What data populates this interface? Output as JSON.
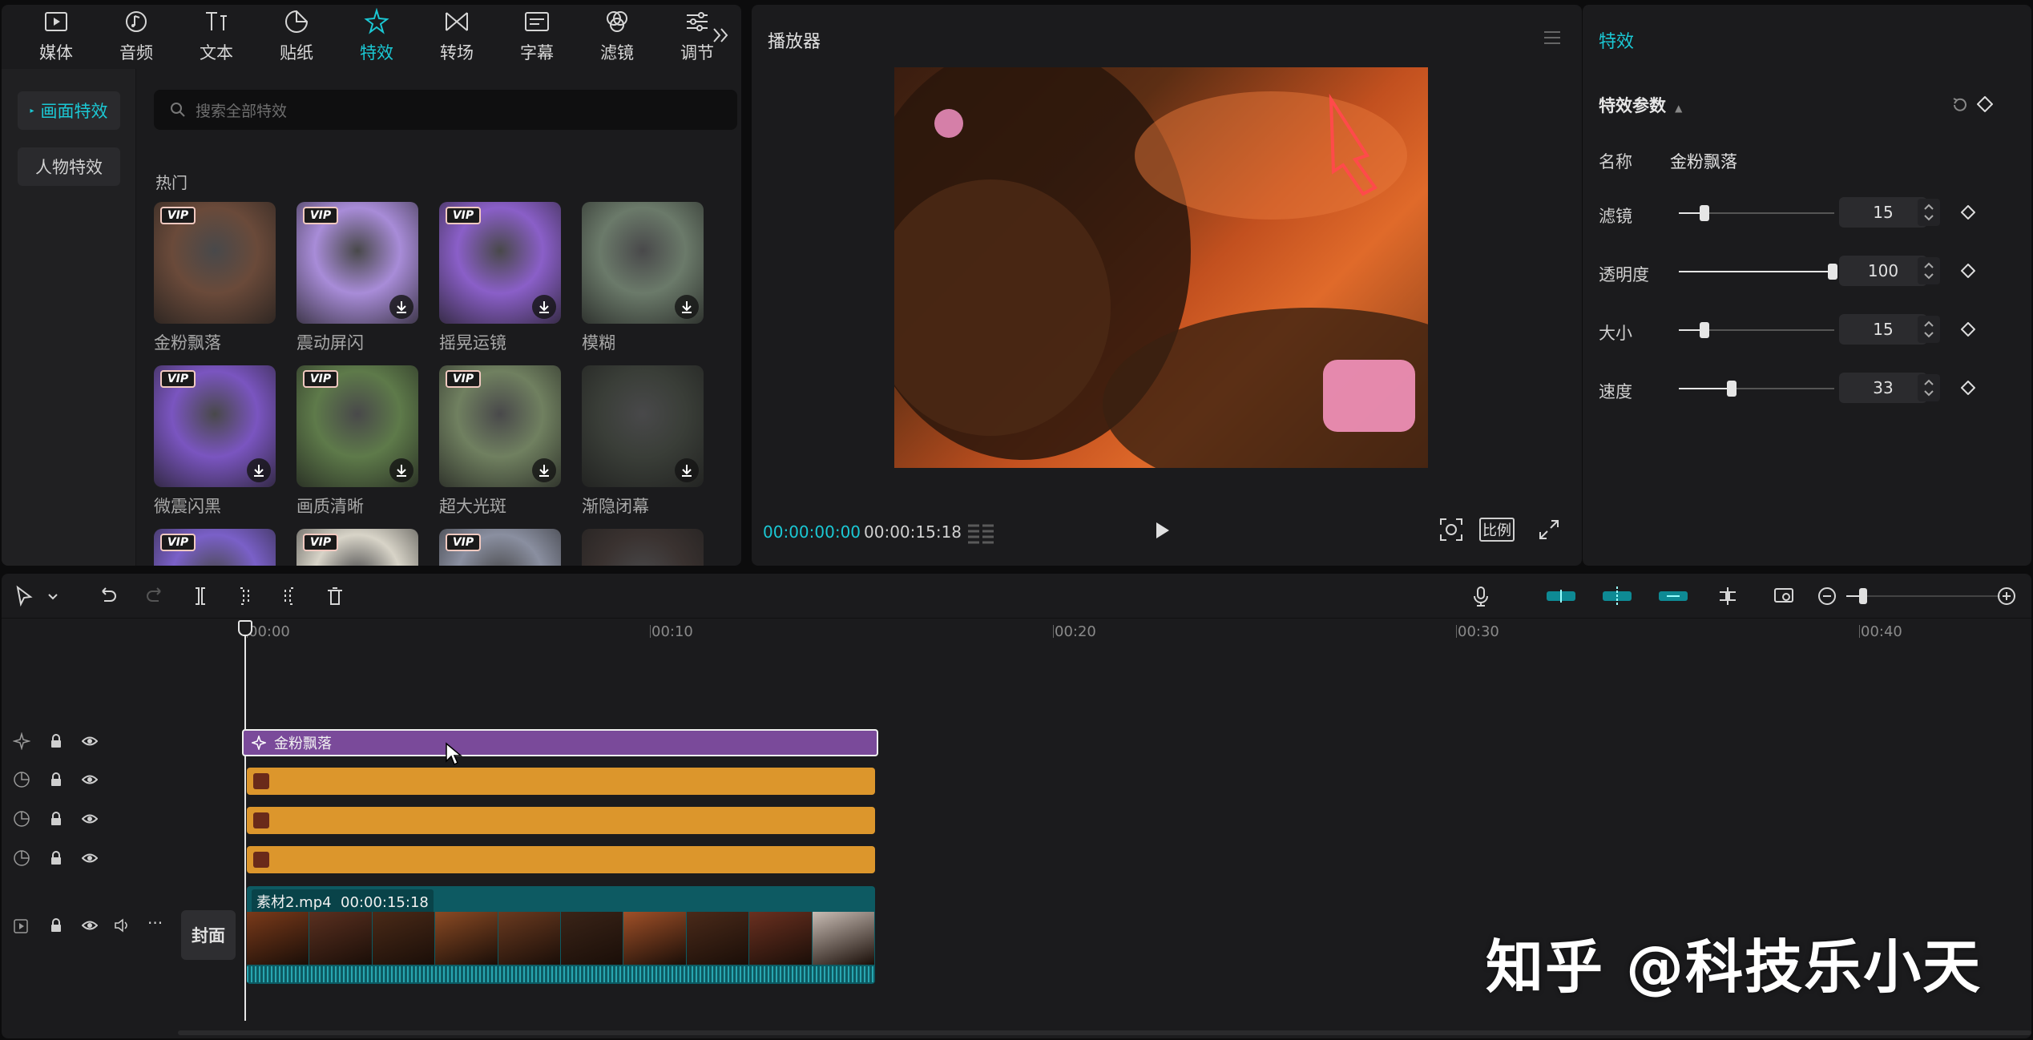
{
  "library": {
    "tabs": [
      {
        "label": "媒体",
        "icon": "media-icon"
      },
      {
        "label": "音频",
        "icon": "audio-icon"
      },
      {
        "label": "文本",
        "icon": "text-icon"
      },
      {
        "label": "贴纸",
        "icon": "sticker-icon"
      },
      {
        "label": "特效",
        "icon": "effect-star-icon",
        "active": true
      },
      {
        "label": "转场",
        "icon": "transition-icon"
      },
      {
        "label": "字幕",
        "icon": "subtitle-icon"
      },
      {
        "label": "滤镜",
        "icon": "filter-icon"
      },
      {
        "label": "调节",
        "icon": "adjust-icon"
      }
    ],
    "categories": [
      {
        "label": "画面特效",
        "active": true
      },
      {
        "label": "人物特效"
      }
    ],
    "search_placeholder": "搜索全部特效",
    "section_title": "热门",
    "effects": [
      {
        "name": "金粉飘落",
        "vip": true,
        "download": false,
        "palette": "#6a4a3a"
      },
      {
        "name": "震动屏闪",
        "vip": true,
        "download": true,
        "palette": "#a88cd8"
      },
      {
        "name": "摇晃运镜",
        "vip": true,
        "download": true,
        "palette": "#8a5fc8"
      },
      {
        "name": "模糊",
        "vip": false,
        "download": true,
        "palette": "#6b7a6a"
      },
      {
        "name": "微震闪黑",
        "vip": true,
        "download": true,
        "palette": "#7a55c0"
      },
      {
        "name": "画质清晰",
        "vip": true,
        "download": true,
        "palette": "#5e7a4a"
      },
      {
        "name": "超大光斑",
        "vip": true,
        "download": true,
        "palette": "#708060"
      },
      {
        "name": "渐隐闭幕",
        "vip": false,
        "download": true,
        "palette": "#3a3e38"
      },
      {
        "name": "",
        "vip": true,
        "download": false,
        "palette": "#7a60c8"
      },
      {
        "name": "",
        "vip": true,
        "download": false,
        "palette": "#d8d4c8"
      },
      {
        "name": "",
        "vip": true,
        "download": false,
        "palette": "#8a8fa0"
      },
      {
        "name": "",
        "vip": false,
        "download": false,
        "palette": "#3a3230"
      }
    ],
    "vip_label": "VIP"
  },
  "player": {
    "title": "播放器",
    "current_time": "00:00:00:00",
    "total_time": "00:00:15:18",
    "ratio_label": "比例"
  },
  "props": {
    "title": "特效",
    "section": "特效参数",
    "name_label": "名称",
    "name_value": "金粉飘落",
    "params": [
      {
        "label": "滤镜",
        "value": "15",
        "fraction": 0.15
      },
      {
        "label": "透明度",
        "value": "100",
        "fraction": 1.0
      },
      {
        "label": "大小",
        "value": "15",
        "fraction": 0.15
      },
      {
        "label": "速度",
        "value": "33",
        "fraction": 0.33
      }
    ]
  },
  "timeline": {
    "ruler": [
      "00:00",
      "00:10",
      "00:20",
      "00:30",
      "00:40"
    ],
    "effect_clip_label": "金粉飘落",
    "video_clip_name": "素材2.mp4",
    "video_clip_duration": "00:00:15:18",
    "cover_label": "封面"
  },
  "watermark": "知乎 @科技乐小天"
}
